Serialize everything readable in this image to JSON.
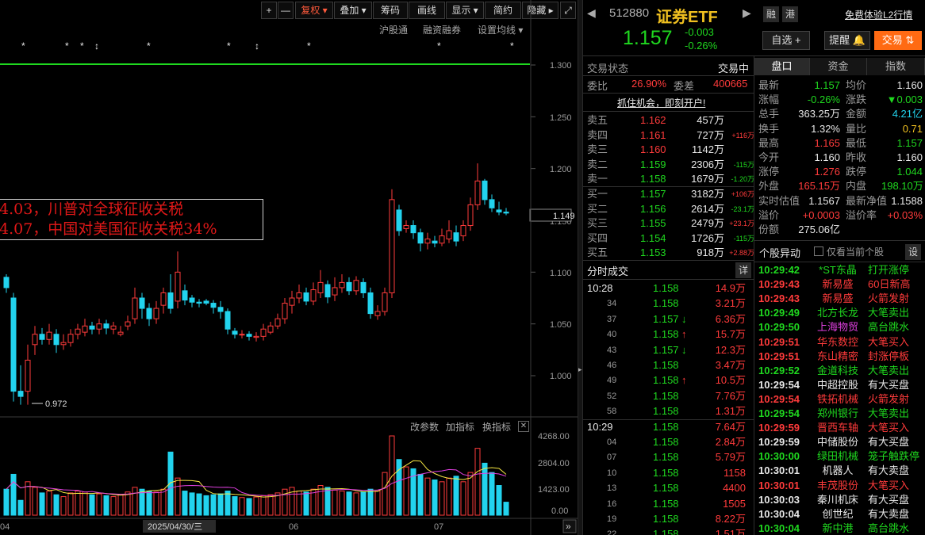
{
  "toolbar": {
    "buttons": [
      "+",
      "—",
      "复权 ▾",
      "叠加 ▾",
      "筹码",
      "画线",
      "显示 ▾",
      "简约",
      "隐藏 ▸",
      "⤢"
    ]
  },
  "subbar": {
    "items": [
      "沪股通",
      "融资融券",
      "设置均线 ▾"
    ]
  },
  "chart": {
    "price_ticks": [
      "1.300",
      "1.250",
      "1.200",
      "1.150",
      "1.100",
      "1.050",
      "1.000"
    ],
    "current_price_tag": "1.149",
    "low_marker": "0.972",
    "annotation_line1": "4.03，川普对全球征收关税",
    "annotation_line2": "4.07，中国对美国征收关税34%",
    "indicator_buttons": [
      "改参数",
      "加指标",
      "换指标",
      "✕"
    ],
    "volume_ticks": [
      "4268.00",
      "2804.00",
      "1423.00",
      "0.00"
    ],
    "date_labels": [
      "04",
      "2025/04/30/三",
      "06",
      "07"
    ],
    "scroll_btn": "»"
  },
  "header": {
    "code": "512880",
    "name": "证券ETF",
    "price": "1.157",
    "change": "-0.003",
    "change_pct": "-0.26%",
    "btn_rong": "融",
    "btn_gang": "港",
    "free_l2": "免费体验L2行情",
    "btn_zixuan": "自选 +",
    "btn_tixing": "提醒 🔔",
    "btn_jiaoyi": "交易 ⇅"
  },
  "status": {
    "label": "交易状态",
    "value": "交易中",
    "weibi_label": "委比",
    "weibi": "26.90%",
    "weicha_label": "委差",
    "weicha": "400665",
    "promo": "抓住机会，即刻开户!"
  },
  "sell_orders": [
    {
      "label": "卖五",
      "price": "1.162",
      "vol": "457万",
      "chg": ""
    },
    {
      "label": "卖四",
      "price": "1.161",
      "vol": "727万",
      "chg": "+116万"
    },
    {
      "label": "卖三",
      "price": "1.160",
      "vol": "1142万",
      "chg": ""
    },
    {
      "label": "卖二",
      "price": "1.159",
      "vol": "2306万",
      "chg": "-115万"
    },
    {
      "label": "卖一",
      "price": "1.158",
      "vol": "1679万",
      "chg": "-1.20万"
    }
  ],
  "buy_orders": [
    {
      "label": "买一",
      "price": "1.157",
      "vol": "3182万",
      "chg": "+106万"
    },
    {
      "label": "买二",
      "price": "1.156",
      "vol": "2614万",
      "chg": "-23.1万"
    },
    {
      "label": "买三",
      "price": "1.155",
      "vol": "2479万",
      "chg": "+23.1万"
    },
    {
      "label": "买四",
      "price": "1.154",
      "vol": "1726万",
      "chg": "-115万"
    },
    {
      "label": "买五",
      "price": "1.153",
      "vol": "918万",
      "chg": "+2.88万"
    }
  ],
  "ticks_header": {
    "title": "分时成交",
    "btn": "详"
  },
  "ticks": [
    {
      "time": "10:28",
      "price": "1.158",
      "arrow": "",
      "vol": "14.9万"
    },
    {
      "time": "34",
      "price": "1.158",
      "arrow": "",
      "vol": "3.21万"
    },
    {
      "time": "37",
      "price": "1.157",
      "arrow": "↓",
      "vol": "6.36万"
    },
    {
      "time": "40",
      "price": "1.158",
      "arrow": "↑",
      "vol": "15.7万"
    },
    {
      "time": "43",
      "price": "1.157",
      "arrow": "↓",
      "vol": "12.3万"
    },
    {
      "time": "46",
      "price": "1.158",
      "arrow": "",
      "vol": "3.47万"
    },
    {
      "time": "49",
      "price": "1.158",
      "arrow": "↑",
      "vol": "10.5万"
    },
    {
      "time": "52",
      "price": "1.158",
      "arrow": "",
      "vol": "7.76万"
    },
    {
      "time": "58",
      "price": "1.158",
      "arrow": "",
      "vol": "1.31万"
    },
    {
      "time": "10:29",
      "price": "1.158",
      "arrow": "",
      "vol": "7.64万"
    },
    {
      "time": "04",
      "price": "1.158",
      "arrow": "",
      "vol": "2.84万"
    },
    {
      "time": "07",
      "price": "1.158",
      "arrow": "",
      "vol": "5.79万"
    },
    {
      "time": "10",
      "price": "1.158",
      "arrow": "",
      "vol": "1158"
    },
    {
      "time": "13",
      "price": "1.158",
      "arrow": "",
      "vol": "4400"
    },
    {
      "time": "16",
      "price": "1.158",
      "arrow": "",
      "vol": "1505"
    },
    {
      "time": "19",
      "price": "1.158",
      "arrow": "",
      "vol": "8.22万"
    },
    {
      "time": "22",
      "price": "1.158",
      "arrow": "",
      "vol": "1.51万"
    }
  ],
  "tabs": [
    "盘口",
    "资金",
    "指数"
  ],
  "quote": [
    {
      "l1": "最新",
      "v1": "1.157",
      "c1": "grn",
      "l2": "均价",
      "v2": "1.160",
      "c2": "wht"
    },
    {
      "l1": "涨幅",
      "v1": "-0.26%",
      "c1": "grn",
      "l2": "涨跌",
      "v2": "▼0.003",
      "c2": "grn"
    },
    {
      "l1": "总手",
      "v1": "363.25万",
      "c1": "wht",
      "l2": "金额",
      "v2": "4.21亿",
      "c2": "cyan"
    },
    {
      "l1": "换手",
      "v1": "1.32%",
      "c1": "wht",
      "l2": "量比",
      "v2": "0.71",
      "c2": "yel"
    },
    {
      "l1": "最高",
      "v1": "1.165",
      "c1": "red",
      "l2": "最低",
      "v2": "1.157",
      "c2": "grn"
    },
    {
      "l1": "今开",
      "v1": "1.160",
      "c1": "wht",
      "l2": "昨收",
      "v2": "1.160",
      "c2": "wht"
    },
    {
      "l1": "涨停",
      "v1": "1.276",
      "c1": "red",
      "l2": "跌停",
      "v2": "1.044",
      "c2": "grn"
    },
    {
      "l1": "外盘",
      "v1": "165.15万",
      "c1": "red",
      "l2": "内盘",
      "v2": "198.10万",
      "c2": "grn"
    },
    {
      "l1": "实时估值",
      "v1": "1.1567",
      "c1": "wht",
      "l2": "最新净值",
      "v2": "1.1588",
      "c2": "wht"
    },
    {
      "l1": "溢价",
      "v1": "+0.0003",
      "c1": "red",
      "l2": "溢价率",
      "v2": "+0.03%",
      "c2": "red"
    },
    {
      "l1": "份额",
      "v1": "275.06亿",
      "c1": "wht",
      "l2": "",
      "v2": "",
      "c2": "wht"
    }
  ],
  "movers_header": {
    "title": "个股异动",
    "checkbox_label": "仅看当前个股",
    "btn": "设"
  },
  "movers": [
    {
      "time": "10:29:42",
      "tc": "grn",
      "name": "*ST东晶",
      "nc": "grn",
      "evt": "打开涨停",
      "ec": "grn"
    },
    {
      "time": "10:29:43",
      "tc": "red",
      "name": "新易盛",
      "nc": "red",
      "evt": "60日新高",
      "ec": "red"
    },
    {
      "time": "10:29:43",
      "tc": "red",
      "name": "新易盛",
      "nc": "red",
      "evt": "火箭发射",
      "ec": "red"
    },
    {
      "time": "10:29:49",
      "tc": "grn",
      "name": "北方长龙",
      "nc": "grn",
      "evt": "大笔卖出",
      "ec": "grn"
    },
    {
      "time": "10:29:50",
      "tc": "grn",
      "name": "上海物贸",
      "nc": "mag",
      "evt": "高台跳水",
      "ec": "grn"
    },
    {
      "time": "10:29:51",
      "tc": "red",
      "name": "华东数控",
      "nc": "red",
      "evt": "大笔买入",
      "ec": "red"
    },
    {
      "time": "10:29:51",
      "tc": "red",
      "name": "东山精密",
      "nc": "red",
      "evt": "封涨停板",
      "ec": "red"
    },
    {
      "time": "10:29:52",
      "tc": "grn",
      "name": "金道科技",
      "nc": "grn",
      "evt": "大笔卖出",
      "ec": "grn"
    },
    {
      "time": "10:29:54",
      "tc": "wht",
      "name": "中超控股",
      "nc": "wht",
      "evt": "有大买盘",
      "ec": "wht"
    },
    {
      "time": "10:29:54",
      "tc": "red",
      "name": "铁拓机械",
      "nc": "red",
      "evt": "火箭发射",
      "ec": "red"
    },
    {
      "time": "10:29:54",
      "tc": "grn",
      "name": "郑州银行",
      "nc": "grn",
      "evt": "大笔卖出",
      "ec": "grn"
    },
    {
      "time": "10:29:59",
      "tc": "red",
      "name": "晋西车轴",
      "nc": "red",
      "evt": "大笔买入",
      "ec": "red"
    },
    {
      "time": "10:29:59",
      "tc": "wht",
      "name": "中储股份",
      "nc": "wht",
      "evt": "有大买盘",
      "ec": "wht"
    },
    {
      "time": "10:30:00",
      "tc": "grn",
      "name": "绿田机械",
      "nc": "grn",
      "evt": "笼子触跌停",
      "ec": "grn"
    },
    {
      "time": "10:30:01",
      "tc": "wht",
      "name": "机器人",
      "nc": "wht",
      "evt": "有大卖盘",
      "ec": "wht"
    },
    {
      "time": "10:30:01",
      "tc": "red",
      "name": "丰茂股份",
      "nc": "red",
      "evt": "大笔买入",
      "ec": "red"
    },
    {
      "time": "10:30:03",
      "tc": "wht",
      "name": "秦川机床",
      "nc": "wht",
      "evt": "有大买盘",
      "ec": "wht"
    },
    {
      "time": "10:30:04",
      "tc": "wht",
      "name": "创世纪",
      "nc": "wht",
      "evt": "有大卖盘",
      "ec": "wht"
    },
    {
      "time": "10:30:04",
      "tc": "grn",
      "name": "新中港",
      "nc": "grn",
      "evt": "高台跳水",
      "ec": "grn"
    }
  ],
  "colors": {
    "up": "#ff3b3b",
    "down": "#22d3ee",
    "ma_line": "#1fd81f",
    "name": "#f0c020"
  }
}
